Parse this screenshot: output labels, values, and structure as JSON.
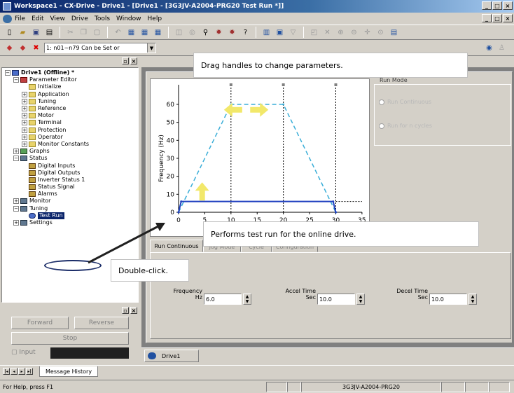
{
  "window": {
    "title": "Workspace1 - CX-Drive - Drive1 - [Drive1 - [3G3JV-A2004-PRG20 Test Run *]]"
  },
  "menu": [
    "File",
    "Edit",
    "View",
    "Drive",
    "Tools",
    "Window",
    "Help"
  ],
  "toolbar2": {
    "param_combo": "1: n01~n79 Can be Set or"
  },
  "tree": {
    "root": "Drive1 (Offline) *",
    "parameter_editor": "Parameter Editor",
    "param_items": [
      "Initialize",
      "Application",
      "Tuning",
      "Reference",
      "Motor",
      "Terminal",
      "Protection",
      "Operator",
      "Monitor Constants"
    ],
    "graphs": "Graphs",
    "status": "Status",
    "status_items": [
      "Digital Inputs",
      "Digital Outputs",
      "Inverter Status 1",
      "Status Signal",
      "Alarms"
    ],
    "monitor": "Monitor",
    "tuning": "Tuning",
    "test_run": "Test Run",
    "settings": "Settings"
  },
  "controls": {
    "forward": "Forward",
    "reverse": "Reverse",
    "stop": "Stop",
    "input": "Input"
  },
  "run_mode": {
    "label": "Run Mode",
    "options": [
      "Run Continuous",
      "Run for n cycles"
    ]
  },
  "tabs": [
    "Run Continuous",
    "Jog Mode",
    "Cycle",
    "Configuration"
  ],
  "fields": {
    "frequency": {
      "label": "Frequency",
      "unit": "Hz",
      "value": "6.0"
    },
    "accel": {
      "label": "Accel Time",
      "unit": "Sec",
      "value": "10.0"
    },
    "decel": {
      "label": "Decel Time",
      "unit": "Sec",
      "value": "10.0"
    }
  },
  "mdi_tab": "Drive1",
  "message_tab": "Message History",
  "statusbar": {
    "help": "For Help, press F1",
    "device": "3G3JV-A2004-PRG20"
  },
  "callouts": {
    "drag": "Drag handles to change parameters.",
    "test_run": "Performs test run for the online drive.",
    "double_click": "Double-click."
  },
  "chart_data": {
    "type": "line",
    "ylabel": "Frequency (Hz)",
    "xlabel": "",
    "xlim": [
      0,
      35
    ],
    "ylim": [
      0,
      60
    ],
    "xticks": [
      0,
      5,
      10,
      15,
      20,
      25,
      30,
      35
    ],
    "yticks": [
      0,
      10,
      20,
      30,
      40,
      50,
      60
    ],
    "series": [
      {
        "style": "dashed",
        "color": "#3aaed8",
        "x": [
          0,
          10,
          20,
          30
        ],
        "y": [
          0,
          60,
          60,
          0
        ]
      },
      {
        "style": "solid",
        "color": "#2040c0",
        "x": [
          0,
          0.5,
          29.5,
          30
        ],
        "y": [
          0,
          6,
          6,
          0
        ]
      }
    ],
    "handle_lines_x": [
      10,
      20,
      30
    ]
  }
}
